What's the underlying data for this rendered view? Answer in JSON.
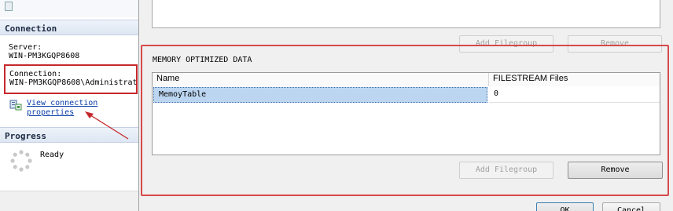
{
  "sidebar": {
    "connection_header": "Connection",
    "server_label": "Server:",
    "server_value": "WIN-PM3KGQP8608",
    "connection_label": "Connection:",
    "connection_value": "WIN-PM3KGQP8608\\Administrat",
    "view_link_line1": "View connection",
    "view_link_line2": "properties",
    "progress_header": "Progress",
    "progress_status": "Ready"
  },
  "upper_buttons": {
    "add_filegroup": "Add Filegroup",
    "remove": "Remove"
  },
  "memory_section": {
    "title": "MEMORY OPTIMIZED DATA",
    "columns": [
      "Name",
      "FILESTREAM Files"
    ],
    "rows": [
      {
        "name": "MemoyTable",
        "files": "0"
      }
    ],
    "add_filegroup": "Add Filegroup",
    "remove": "Remove"
  },
  "dialog_buttons": {
    "ok": "OK",
    "cancel": "Cancel"
  },
  "colors": {
    "highlight_red": "#d6494a",
    "selection_blue": "#bcd6f1",
    "link_blue": "#0b3ea8"
  }
}
